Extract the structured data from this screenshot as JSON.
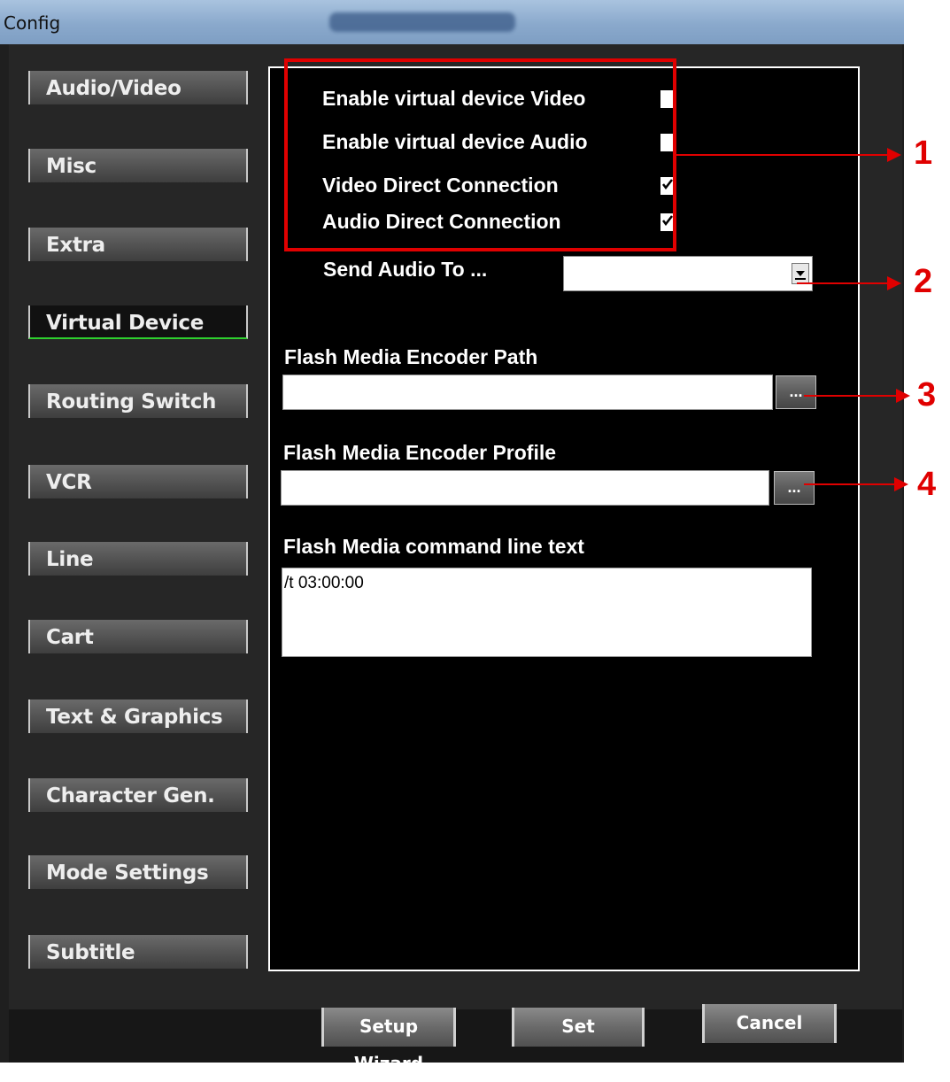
{
  "window": {
    "title": "Config",
    "title_blurred": "00:05:38.29"
  },
  "nav": [
    {
      "label": "Audio/Video",
      "active": false
    },
    {
      "label": "Misc",
      "active": false
    },
    {
      "label": "Extra",
      "active": false
    },
    {
      "label": "Virtual Device",
      "active": true
    },
    {
      "label": "Routing Switch",
      "active": false
    },
    {
      "label": "VCR",
      "active": false
    },
    {
      "label": "Line",
      "active": false
    },
    {
      "label": "Cart",
      "active": false
    },
    {
      "label": "Text & Graphics",
      "active": false
    },
    {
      "label": "Character Gen.",
      "active": false
    },
    {
      "label": "Mode Settings",
      "active": false
    },
    {
      "label": "Subtitle",
      "active": false
    }
  ],
  "virtual_device": {
    "options": [
      {
        "label": "Enable virtual device Video",
        "checked": false
      },
      {
        "label": "Enable virtual device Audio",
        "checked": false
      },
      {
        "label": "Video Direct Connection",
        "checked": true
      },
      {
        "label": "Audio Direct Connection",
        "checked": true
      }
    ],
    "send_audio_label": "Send Audio To ...",
    "send_audio_value": "",
    "encoder_path_label": "Flash Media Encoder Path",
    "encoder_path_value": "",
    "encoder_profile_label": "Flash Media Encoder Profile",
    "encoder_profile_value": "",
    "browse_label": "...",
    "cmdline_label": "Flash Media command line text",
    "cmdline_value": "/t 03:00:00"
  },
  "footer": {
    "setup_wizard": "Setup Wizard",
    "set": "Set",
    "cancel": "Cancel"
  },
  "annotations": [
    "1",
    "2",
    "3",
    "4"
  ],
  "colors": {
    "annotation": "#e00000",
    "active_underline": "#2ecf2e"
  }
}
